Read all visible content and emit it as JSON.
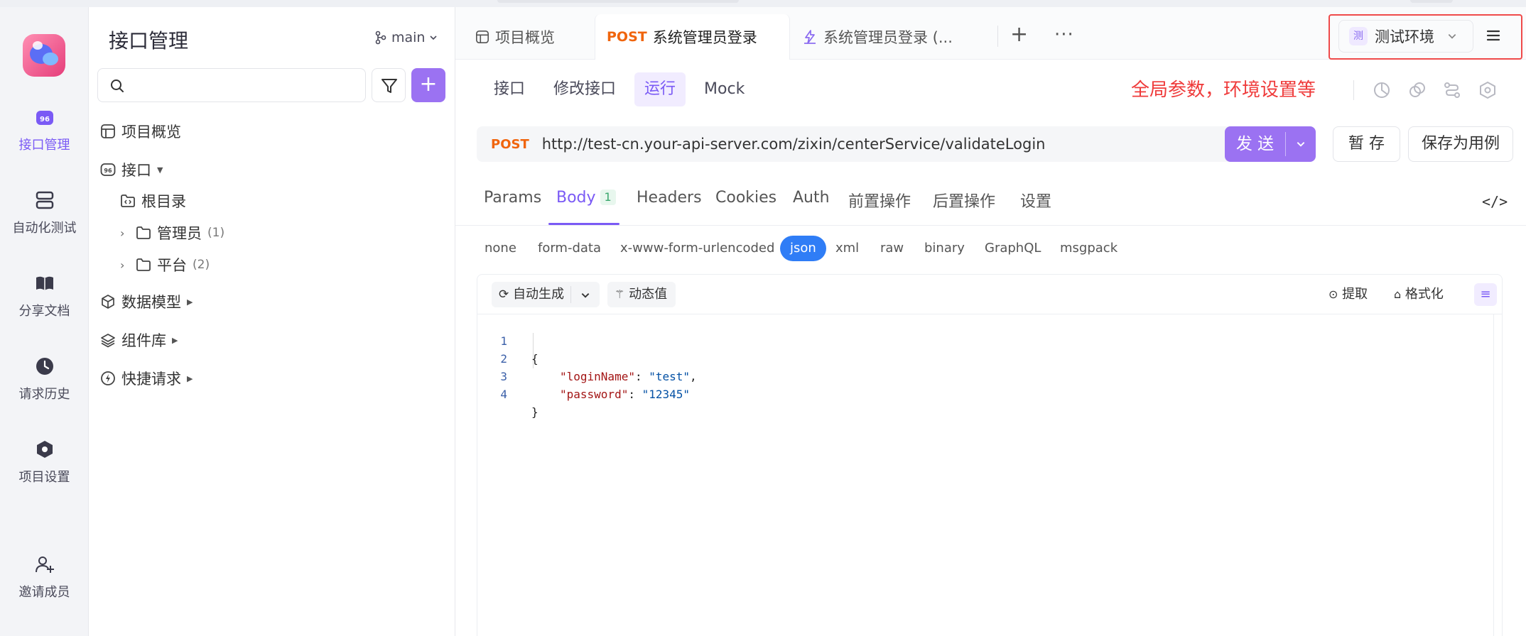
{
  "rail": {
    "items": [
      {
        "label": "接口管理"
      },
      {
        "label": "自动化测试"
      },
      {
        "label": "分享文档"
      },
      {
        "label": "请求历史"
      },
      {
        "label": "项目设置"
      },
      {
        "label": "邀请成员"
      }
    ]
  },
  "left_panel": {
    "title": "接口管理",
    "branch": "main",
    "search": {
      "value": "",
      "placeholder": ""
    },
    "add_label": "+",
    "tree": {
      "overview": "项目概览",
      "apis": "接口",
      "root": "根目录",
      "folders": [
        {
          "name": "管理员",
          "count": "(1)"
        },
        {
          "name": "平台",
          "count": "(2)"
        }
      ],
      "data_models": "数据模型",
      "components": "组件库",
      "quick_requests": "快捷请求"
    }
  },
  "tabs": [
    {
      "label": "项目概览"
    },
    {
      "method": "POST",
      "label": "系统管理员登录"
    },
    {
      "label": "系统管理员登录 (..."
    }
  ],
  "tab_add": "+",
  "tab_more": "···",
  "environment": {
    "tag": "测",
    "label": "测试环境"
  },
  "subtabs": [
    "接口",
    "修改接口",
    "运行",
    "Mock"
  ],
  "annotation": "全局参数，环境设置等",
  "request": {
    "method": "POST",
    "url": "http://test-cn.your-api-server.com/zixin/centerService/validateLogin",
    "send": "发 送",
    "save_temp": "暂 存",
    "save_case": "保存为用例"
  },
  "request_tabs": [
    {
      "label": "Params"
    },
    {
      "label": "Body",
      "badge": "1"
    },
    {
      "label": "Headers"
    },
    {
      "label": "Cookies"
    },
    {
      "label": "Auth"
    },
    {
      "label": "前置操作"
    },
    {
      "label": "后置操作"
    },
    {
      "label": "设置"
    }
  ],
  "code_toggle": "</>",
  "body_types": [
    "none",
    "form-data",
    "x-www-form-urlencoded",
    "json",
    "xml",
    "raw",
    "binary",
    "GraphQL",
    "msgpack"
  ],
  "editor": {
    "auto_generate": "自动生成",
    "dynamic_value": "动态值",
    "extract": "提取",
    "format": "格式化",
    "lines": [
      {
        "n": "1",
        "text": "{"
      },
      {
        "n": "2",
        "key": "\"loginName\"",
        "value": "\"test\"",
        "trail": ","
      },
      {
        "n": "3",
        "key": "\"password\"",
        "value": "\"12345\"",
        "trail": ""
      },
      {
        "n": "4",
        "text": "}"
      }
    ]
  },
  "colors": {
    "accent": "#9b72f2",
    "post": "#f0650d",
    "json_pill": "#2f7df6",
    "annotation": "#ef3b3b"
  }
}
